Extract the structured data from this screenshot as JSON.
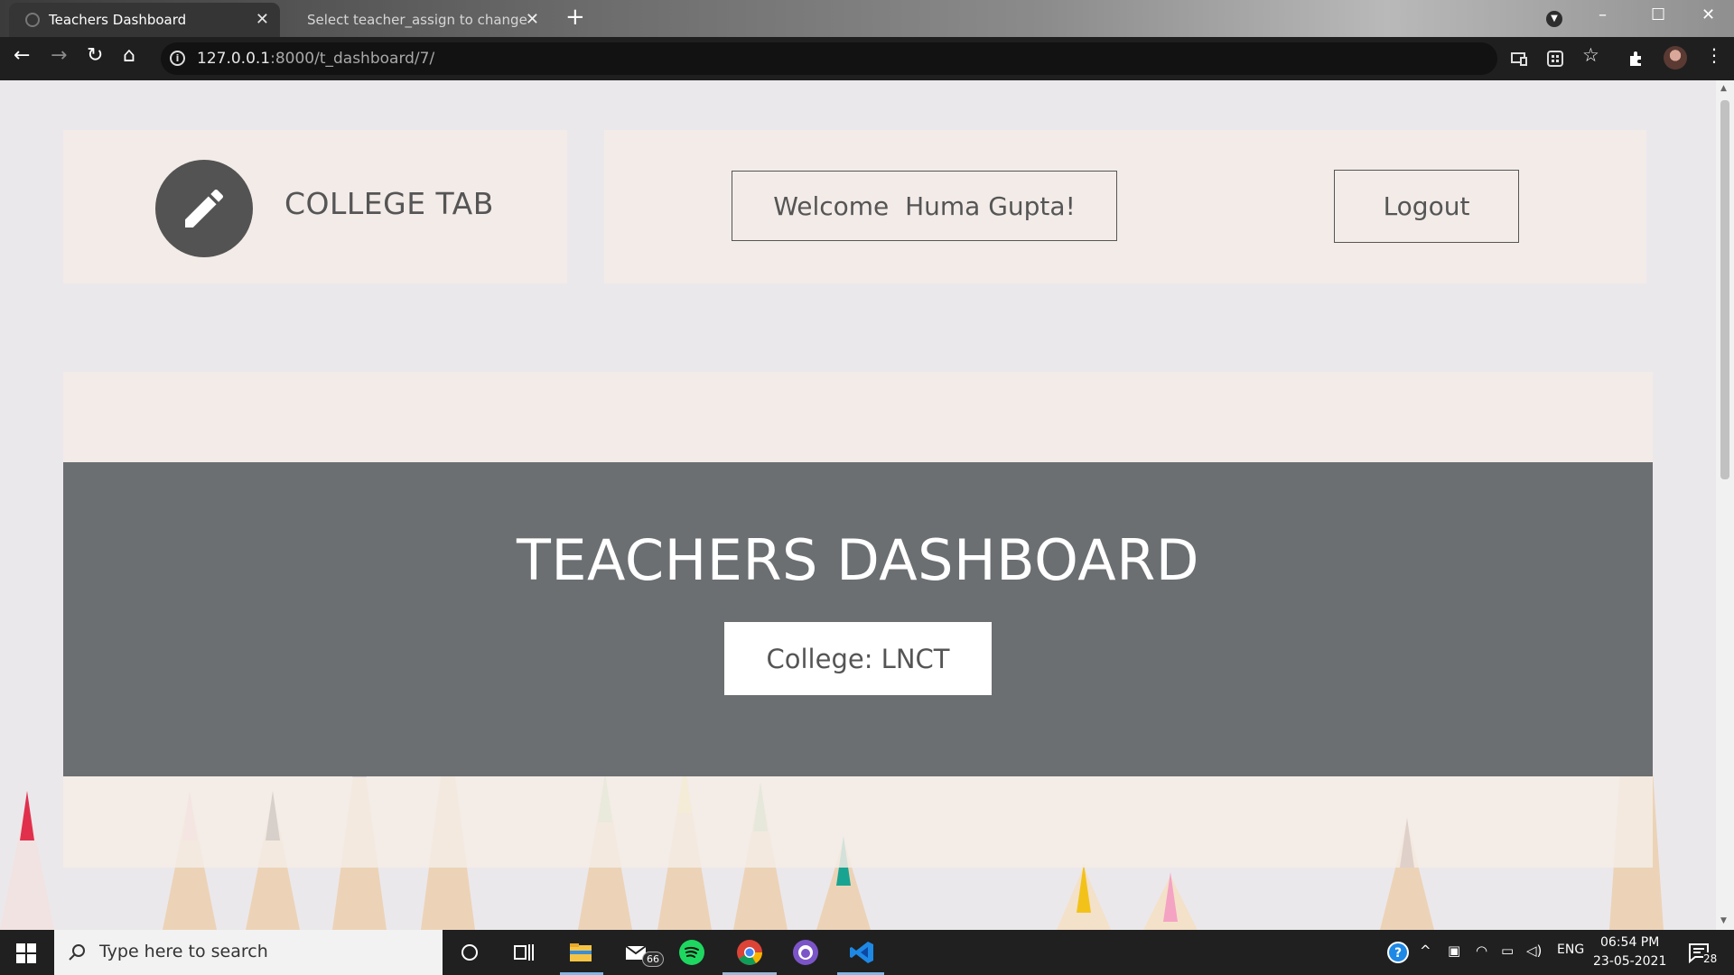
{
  "browser": {
    "active_tab": "Teachers Dashboard",
    "inactive_tab": "Select teacher_assign to change",
    "url_host": "127.0.0.1",
    "url_rest": ":8000/t_dashboard/7/"
  },
  "site": {
    "brand": "COLLEGE TAB",
    "welcome": "Welcome  Huma Gupta!",
    "logout": "Logout"
  },
  "hero": {
    "title": "TEACHERS DASHBOARD",
    "college": "College: LNCT"
  },
  "taskbar": {
    "search_placeholder": "Type here to search",
    "mail_badge": "66",
    "language": "ENG",
    "time": "06:54 PM",
    "date": "23-05-2021",
    "notifications": "28"
  },
  "colors": {
    "hero_bg": "#6b6f72",
    "card_bg": "#f2ebe8",
    "logo_circle": "#535353"
  }
}
